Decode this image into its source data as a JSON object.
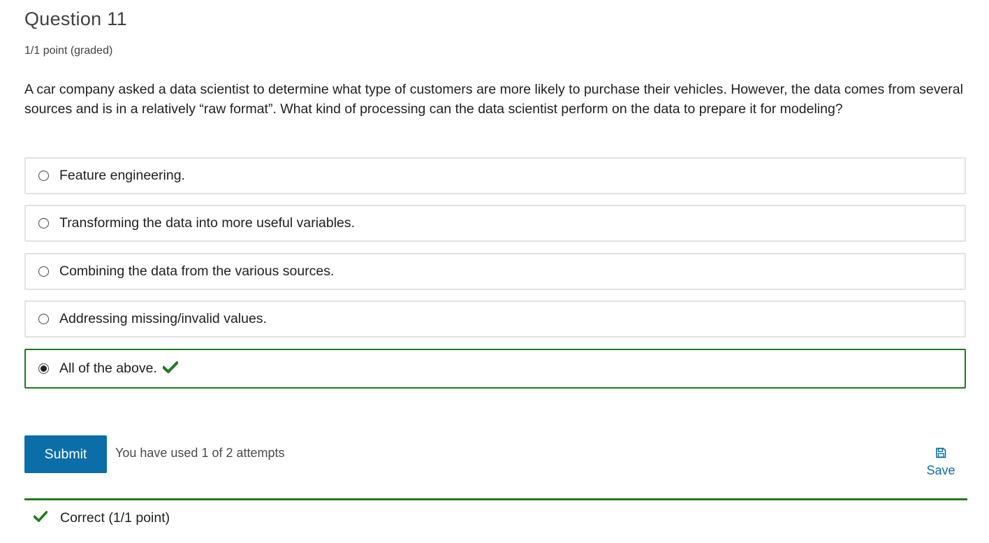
{
  "question": {
    "title": "Question 11",
    "points": "1/1 point (graded)",
    "text": "A car company asked a data scientist to determine what type of customers are more likely to purchase their vehicles. However, the data comes from several sources and is in a relatively “raw format”. What kind of processing can the data scientist perform on the data to prepare it for modeling?"
  },
  "options": [
    {
      "label": "Feature engineering.",
      "selected": false
    },
    {
      "label": "Transforming the data into more useful variables.",
      "selected": false
    },
    {
      "label": "Combining the data from the various sources.",
      "selected": false
    },
    {
      "label": "Addressing missing/invalid values.",
      "selected": false
    },
    {
      "label": "All of the above.",
      "selected": true,
      "correct": true
    }
  ],
  "actions": {
    "submit_label": "Submit",
    "attempts_text": "You have used 1 of 2 attempts",
    "save_label": "Save"
  },
  "feedback": {
    "text": "Correct (1/1 point)"
  },
  "colors": {
    "accent": "#0b6ea8",
    "correct": "#1f7a1f",
    "border": "#e1e1e1"
  },
  "icons": {
    "correct": "check-icon",
    "save": "save-icon"
  }
}
